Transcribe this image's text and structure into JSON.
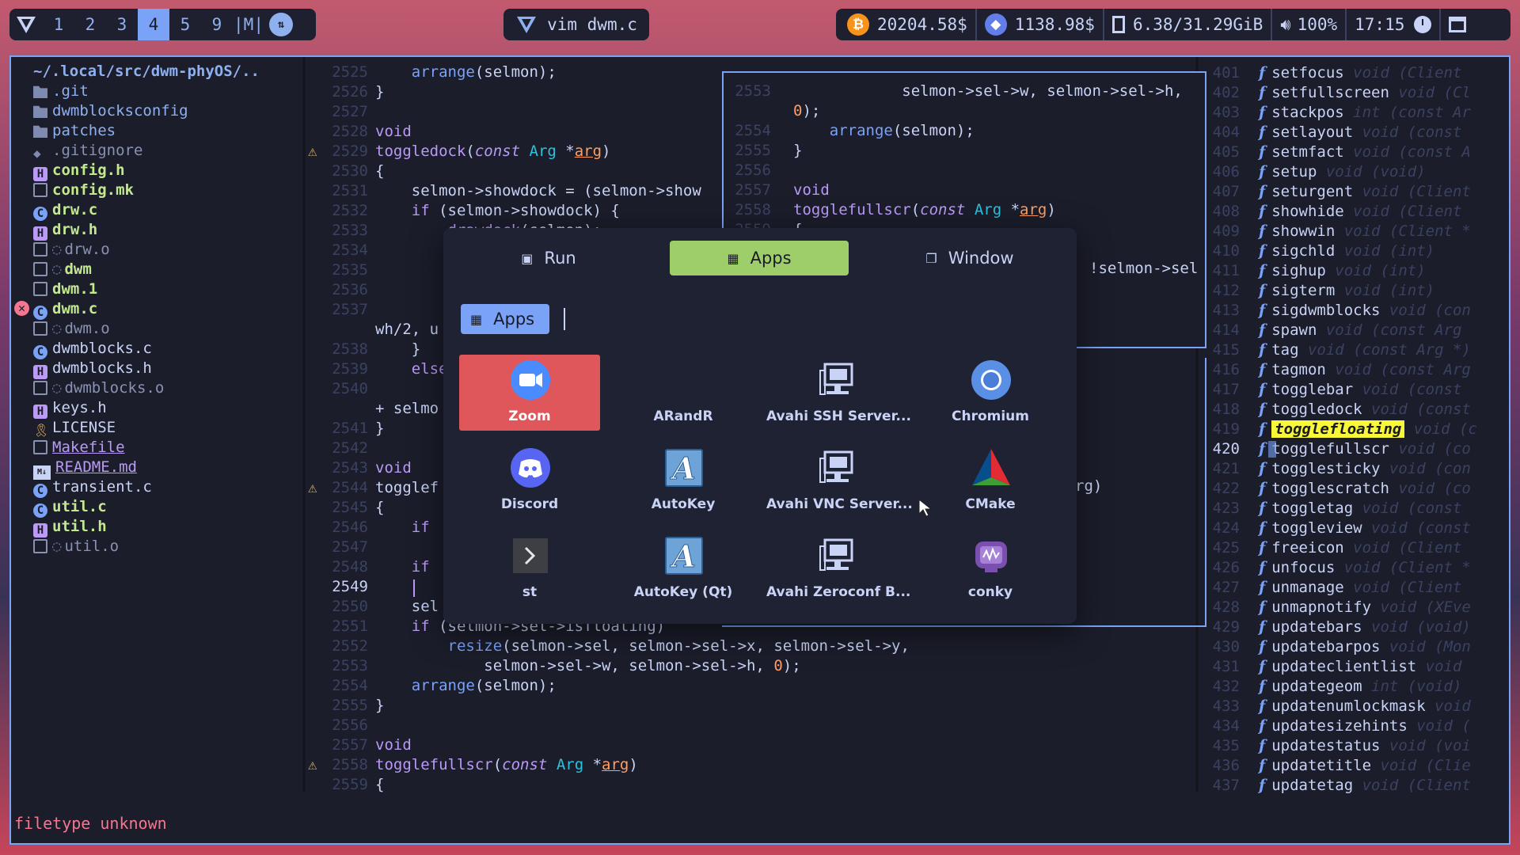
{
  "topbar": {
    "workspaces": [
      "1",
      "2",
      "3",
      "4",
      "5",
      "9",
      "|M|"
    ],
    "active_workspace": "4",
    "window_title": "vim dwm.c",
    "btc": "20204.58$",
    "eth": "1138.98$",
    "mem": "6.38/31.29GiB",
    "volume": "100%",
    "clock": "17:15"
  },
  "filetree": {
    "root": "~/.local/src/dwm-phyOS/..",
    "items": [
      {
        "name": ".git",
        "kind": "folder",
        "color": "#8fb0ee"
      },
      {
        "name": "dwmblocksconfig",
        "kind": "folder",
        "color": "#8fb0ee"
      },
      {
        "name": "patches",
        "kind": "folder",
        "color": "#8fb0ee"
      },
      {
        "name": ".gitignore",
        "kind": "git",
        "color": "#8a92b2"
      },
      {
        "name": "config.h",
        "kind": "h",
        "color": "#c3e88d"
      },
      {
        "name": "config.mk",
        "kind": "file",
        "color": "#c3e88d"
      },
      {
        "name": "drw.c",
        "kind": "c",
        "color": "#c3e88d"
      },
      {
        "name": "drw.h",
        "kind": "h",
        "color": "#c3e88d"
      },
      {
        "name": "drw.o",
        "kind": "obj",
        "color": "#8a92b2"
      },
      {
        "name": "dwm",
        "kind": "obj",
        "color": "#c3e88d"
      },
      {
        "name": "dwm.1",
        "kind": "file",
        "color": "#c3e88d"
      },
      {
        "name": "dwm.c",
        "kind": "c",
        "color": "#c3e88d"
      },
      {
        "name": "dwm.o",
        "kind": "obj",
        "color": "#8a92b2"
      },
      {
        "name": "dwmblocks.c",
        "kind": "c",
        "color": "#c8d3f5"
      },
      {
        "name": "dwmblocks.h",
        "kind": "h",
        "color": "#c8d3f5"
      },
      {
        "name": "dwmblocks.o",
        "kind": "obj",
        "color": "#8a92b2"
      },
      {
        "name": "keys.h",
        "kind": "h",
        "color": "#c8d3f5"
      },
      {
        "name": "LICENSE",
        "kind": "key",
        "color": "#c8d3f5"
      },
      {
        "name": "Makefile",
        "kind": "file",
        "color": "#bb9af7"
      },
      {
        "name": "README.md",
        "kind": "md",
        "color": "#bb9af7"
      },
      {
        "name": "transient.c",
        "kind": "c",
        "color": "#c8d3f5"
      },
      {
        "name": "util.c",
        "kind": "c",
        "color": "#c3e88d"
      },
      {
        "name": "util.h",
        "kind": "h",
        "color": "#c3e88d"
      },
      {
        "name": "util.o",
        "kind": "obj",
        "color": "#8a92b2"
      }
    ]
  },
  "editor": {
    "lines": [
      {
        "n": "2525",
        "t": "    arrange(selmon);"
      },
      {
        "n": "2526",
        "t": "}"
      },
      {
        "n": "2527",
        "t": ""
      },
      {
        "n": "2528",
        "t": "void"
      },
      {
        "n": "2529",
        "t": "toggledock(const Arg *arg)",
        "warn": true
      },
      {
        "n": "2530",
        "t": "{"
      },
      {
        "n": "2531",
        "t": "    selmon->showdock = (selmon->show"
      },
      {
        "n": "2532",
        "t": "    if (selmon->showdock) {"
      },
      {
        "n": "2533",
        "t": "        drawdock(selmon);"
      },
      {
        "n": "2534",
        "t": ""
      },
      {
        "n": "2535",
        "t": ""
      },
      {
        "n": "2536",
        "t": ""
      },
      {
        "n": "2537",
        "t": ""
      },
      {
        "n": "",
        "t": "wh/2, u"
      },
      {
        "n": "2538",
        "t": "    }"
      },
      {
        "n": "2539",
        "t": "    else"
      },
      {
        "n": "2540",
        "t": ""
      },
      {
        "n": "",
        "t": "+ selmo"
      },
      {
        "n": "2541",
        "t": "}"
      },
      {
        "n": "2542",
        "t": ""
      },
      {
        "n": "2543",
        "t": "void"
      },
      {
        "n": "2544",
        "t": "togglef",
        "warn": true
      },
      {
        "n": "2545",
        "t": "{"
      },
      {
        "n": "2546",
        "t": "    if"
      },
      {
        "n": "2547",
        "t": ""
      },
      {
        "n": "2548",
        "t": "    if"
      },
      {
        "n": "2549",
        "t": "",
        "cur": true
      },
      {
        "n": "2550",
        "t": "    sel"
      },
      {
        "n": "2551",
        "t": "    if (selmon->sel->isfloating)"
      },
      {
        "n": "2552",
        "t": "        resize(selmon->sel, selmon->sel->x, selmon->sel->y,"
      },
      {
        "n": "2553",
        "t": "            selmon->sel->w, selmon->sel->h, 0);"
      },
      {
        "n": "2554",
        "t": "    arrange(selmon);"
      },
      {
        "n": "2555",
        "t": "}"
      },
      {
        "n": "2556",
        "t": ""
      },
      {
        "n": "2557",
        "t": "void"
      },
      {
        "n": "2558",
        "t": "togglefullscr(const Arg *arg)",
        "warn": true
      },
      {
        "n": "2559",
        "t": "{"
      }
    ],
    "float_lines": [
      {
        "n": "2553",
        "t": "            selmon->sel->w, selmon->sel->h,"
      },
      {
        "n": "",
        "t": "0);"
      },
      {
        "n": "2554",
        "t": "    arrange(selmon);"
      },
      {
        "n": "2555",
        "t": "}"
      },
      {
        "n": "2556",
        "t": ""
      },
      {
        "n": "2557",
        "t": "void"
      },
      {
        "n": "2558",
        "t": "togglefullscr(const Arg *arg)"
      },
      {
        "n": "2559",
        "t": "{"
      }
    ],
    "side_fragments": [
      "!selmon->sel",
      "rg)"
    ],
    "statusline": "filetype unknown"
  },
  "outline": {
    "items": [
      {
        "n": "401",
        "name": "setfocus",
        "sig": "void (Client"
      },
      {
        "n": "402",
        "name": "setfullscreen",
        "sig": "void (Cl"
      },
      {
        "n": "403",
        "name": "stackpos",
        "sig": "int (const Ar"
      },
      {
        "n": "404",
        "name": "setlayout",
        "sig": "void (const"
      },
      {
        "n": "405",
        "name": "setmfact",
        "sig": "void (const A"
      },
      {
        "n": "406",
        "name": "setup",
        "sig": "void (void)"
      },
      {
        "n": "407",
        "name": "seturgent",
        "sig": "void (Client"
      },
      {
        "n": "408",
        "name": "showhide",
        "sig": "void (Client"
      },
      {
        "n": "409",
        "name": "showwin",
        "sig": "void (Client *"
      },
      {
        "n": "410",
        "name": "sigchld",
        "sig": "void (int)"
      },
      {
        "n": "411",
        "name": "sighup",
        "sig": "void (int)"
      },
      {
        "n": "412",
        "name": "sigterm",
        "sig": "void (int)"
      },
      {
        "n": "413",
        "name": "sigdwmblocks",
        "sig": "void (con"
      },
      {
        "n": "414",
        "name": "spawn",
        "sig": "void (const Arg"
      },
      {
        "n": "415",
        "name": "tag",
        "sig": "void (const Arg *)"
      },
      {
        "n": "416",
        "name": "tagmon",
        "sig": "void (const Arg"
      },
      {
        "n": "417",
        "name": "togglebar",
        "sig": "void (const"
      },
      {
        "n": "418",
        "name": "toggledock",
        "sig": "void (const"
      },
      {
        "n": "419",
        "name": "togglefloating",
        "sig": "void (c",
        "hl": true
      },
      {
        "n": "420",
        "name": "togglefullscr",
        "sig": "void (co",
        "cur": true
      },
      {
        "n": "421",
        "name": "togglesticky",
        "sig": "void (con"
      },
      {
        "n": "422",
        "name": "togglescratch",
        "sig": "void (co"
      },
      {
        "n": "423",
        "name": "toggletag",
        "sig": "void (const"
      },
      {
        "n": "424",
        "name": "toggleview",
        "sig": "void (const"
      },
      {
        "n": "425",
        "name": "freeicon",
        "sig": "void (Client"
      },
      {
        "n": "426",
        "name": "unfocus",
        "sig": "void (Client *"
      },
      {
        "n": "427",
        "name": "unmanage",
        "sig": "void (Client"
      },
      {
        "n": "428",
        "name": "unmapnotify",
        "sig": "void (XEve"
      },
      {
        "n": "429",
        "name": "updatebars",
        "sig": "void (void)"
      },
      {
        "n": "430",
        "name": "updatebarpos",
        "sig": "void (Mon"
      },
      {
        "n": "431",
        "name": "updateclientlist",
        "sig": "void"
      },
      {
        "n": "432",
        "name": "updategeom",
        "sig": "int (void)"
      },
      {
        "n": "433",
        "name": "updatenumlockmask",
        "sig": "void"
      },
      {
        "n": "434",
        "name": "updatesizehints",
        "sig": "void ("
      },
      {
        "n": "435",
        "name": "updatestatus",
        "sig": "void (voi"
      },
      {
        "n": "436",
        "name": "updatetitle",
        "sig": "void (Clie"
      },
      {
        "n": "437",
        "name": "updatetag",
        "sig": "void (Client"
      }
    ]
  },
  "launcher": {
    "modes": [
      "Run",
      "Apps",
      "Window"
    ],
    "selected_mode": "Apps",
    "prompt": "Apps",
    "apps": [
      {
        "name": "Zoom",
        "icon": "zoom-icon",
        "selected": true
      },
      {
        "name": "ARandR",
        "icon": "arandr-icon"
      },
      {
        "name": "Avahi SSH Server...",
        "icon": "network-server-icon"
      },
      {
        "name": "Chromium",
        "icon": "chromium-icon"
      },
      {
        "name": "Discord",
        "icon": "discord-icon"
      },
      {
        "name": "AutoKey",
        "icon": "autokey-icon"
      },
      {
        "name": "Avahi VNC Server...",
        "icon": "network-server-icon"
      },
      {
        "name": "CMake",
        "icon": "cmake-icon"
      },
      {
        "name": "st",
        "icon": "terminal-icon"
      },
      {
        "name": "AutoKey (Qt)",
        "icon": "autokey-icon"
      },
      {
        "name": "Avahi Zeroconf B...",
        "icon": "network-server-icon"
      },
      {
        "name": "conky",
        "icon": "conky-icon"
      }
    ]
  }
}
